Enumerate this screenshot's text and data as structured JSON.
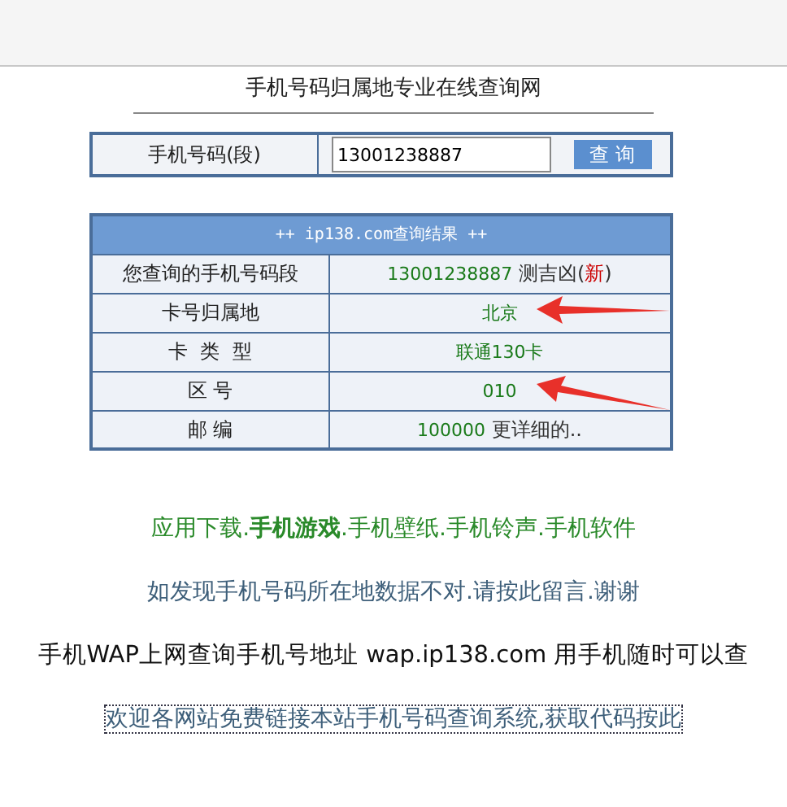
{
  "title": "手机号码归属地专业在线查询网",
  "search": {
    "label": "手机号码(段)",
    "value": "13001238887",
    "button": "查 询"
  },
  "results": {
    "header": "++ ip138.com查询结果 ++",
    "rows": [
      {
        "label": "您查询的手机号码段",
        "value": "13001238887",
        "note": "测吉凶(",
        "note_mark": "新",
        "note_end": ")",
        "arrow": false
      },
      {
        "label": "卡号归属地",
        "value": "北京",
        "arrow": true
      },
      {
        "label": "卡  类  型",
        "value": "联通130卡",
        "arrow": false
      },
      {
        "label": "区 号",
        "value": "010",
        "arrow": true
      },
      {
        "label": "邮 编",
        "value": "100000",
        "note": "更详细的..",
        "arrow": false
      }
    ]
  },
  "links": [
    {
      "kind": "green",
      "text": "应用下载.**手机游戏**.手机壁纸.手机铃声.手机软件",
      "focused": false
    },
    {
      "kind": "slate",
      "text": "如发现手机号码所在地数据不对.请按此留言.谢谢",
      "focused": false
    },
    {
      "kind": "plain",
      "text": "手机WAP上网查询手机号地址 wap.ip138.com 用手机随时可以查",
      "focused": false
    },
    {
      "kind": "slate",
      "text": "欢迎各网站免费链接本站手机号码查询系统,获取代码按此",
      "focused": true
    }
  ]
}
